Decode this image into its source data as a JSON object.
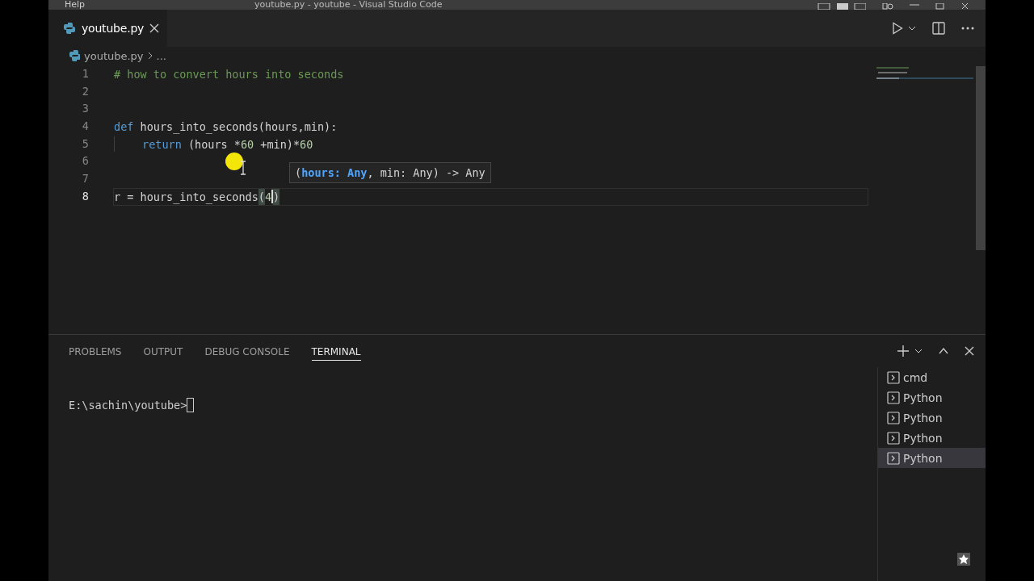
{
  "title_bar": {
    "menu": "Help",
    "title": "youtube.py - youtube - Visual Studio Code"
  },
  "tabs": [
    {
      "label": "youtube.py",
      "selected": true
    }
  ],
  "breadcrumb": {
    "file": "youtube.py",
    "more": "..."
  },
  "editor": {
    "lines": [
      {
        "number": "1",
        "current": false,
        "tokens": [
          {
            "kind": "comment",
            "text": "# how to convert hours into seconds"
          }
        ]
      },
      {
        "number": "2",
        "current": false
      },
      {
        "number": "3",
        "current": false
      },
      {
        "number": "4",
        "current": false,
        "tokens": [
          {
            "kind": "keyword",
            "text": "def"
          },
          {
            "kind": "plain",
            "text": " hours_into_seconds(hours,min):"
          }
        ]
      },
      {
        "number": "5",
        "current": false,
        "indented": true,
        "tokens": [
          {
            "kind": "keyword",
            "text": "return"
          },
          {
            "kind": "plain",
            "text": " (hours *"
          },
          {
            "kind": "number",
            "text": "60"
          },
          {
            "kind": "plain",
            "text": " +min)*"
          },
          {
            "kind": "number",
            "text": "60"
          }
        ]
      },
      {
        "number": "6",
        "current": false
      },
      {
        "number": "7",
        "current": false
      },
      {
        "number": "8",
        "current": true,
        "tokens": [
          {
            "kind": "plain",
            "text": "r = hours_into_seconds"
          },
          {
            "kind": "bracket",
            "text": "("
          },
          {
            "kind": "number",
            "text": "4"
          },
          {
            "kind": "caret"
          },
          {
            "kind": "bracket",
            "text": ")"
          }
        ]
      }
    ],
    "hover": {
      "tokens": [
        {
          "kind": "plain",
          "text": "("
        },
        {
          "kind": "param",
          "text": "hours: Any"
        },
        {
          "kind": "plain",
          "text": ", min: Any) -> Any"
        }
      ]
    }
  },
  "panel": {
    "tabs": [
      {
        "label": "PROBLEMS",
        "selected": false
      },
      {
        "label": "OUTPUT",
        "selected": false
      },
      {
        "label": "DEBUG CONSOLE",
        "selected": false
      },
      {
        "label": "TERMINAL",
        "selected": true
      }
    ],
    "terminal": {
      "prompt": "E:\\sachin\\youtube>"
    },
    "terminals": [
      {
        "label": "cmd",
        "selected": false
      },
      {
        "label": "Python",
        "selected": false
      },
      {
        "label": "Python",
        "selected": false
      },
      {
        "label": "Python",
        "selected": false
      },
      {
        "label": "Python",
        "selected": true
      }
    ]
  }
}
